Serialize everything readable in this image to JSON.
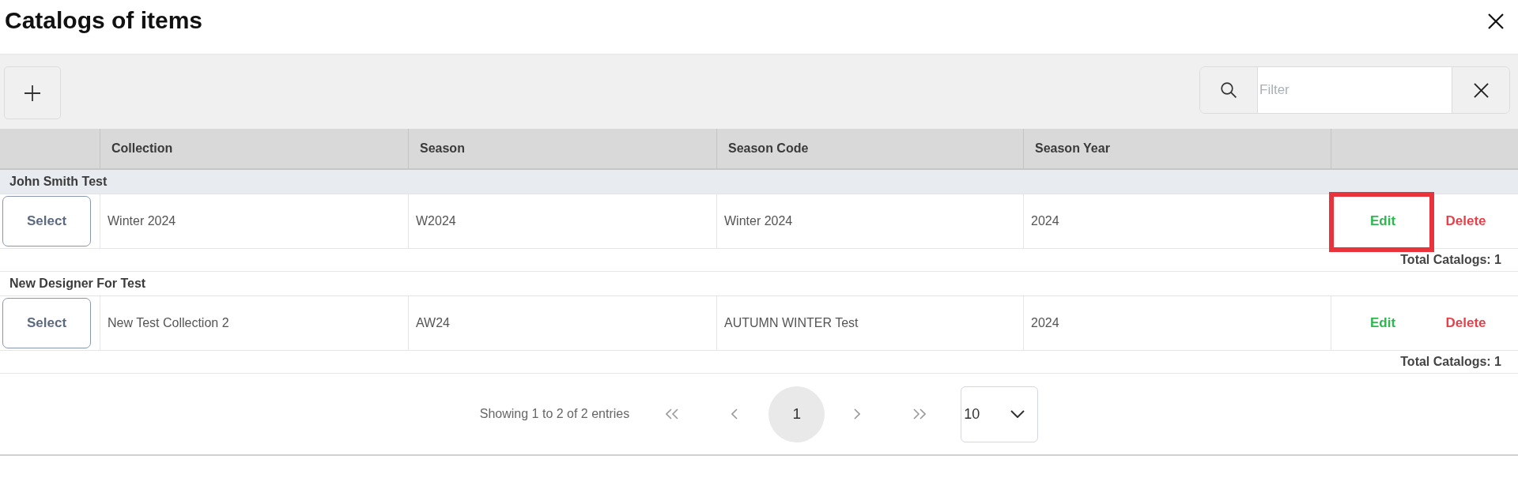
{
  "dialog": {
    "title": "Catalogs of items"
  },
  "toolbar": {
    "filter": {
      "placeholder": "Filter"
    }
  },
  "table": {
    "columns": [
      "Collection",
      "Season",
      "Season Code",
      "Season Year"
    ],
    "groups": [
      {
        "name": "John Smith Test",
        "highlighted": true,
        "rows": [
          {
            "select": "Select",
            "cells": [
              "Winter 2024",
              "W2024",
              "Winter 2024",
              "2024"
            ],
            "actions": [
              {
                "kind": "edit",
                "label": "Edit",
                "annotated": true
              },
              {
                "kind": "delete",
                "label": "Delete",
                "annotated": false
              }
            ]
          }
        ],
        "total": "Total Catalogs: 1"
      },
      {
        "name": "New Designer For Test",
        "highlighted": false,
        "rows": [
          {
            "select": "Select",
            "cells": [
              "New Test Collection 2",
              "AW24",
              "AUTUMN WINTER Test",
              "2024"
            ],
            "actions": [
              {
                "kind": "edit",
                "label": "Edit",
                "annotated": false
              },
              {
                "kind": "delete",
                "label": "Delete",
                "annotated": false
              }
            ]
          }
        ],
        "total": "Total Catalogs: 1"
      }
    ]
  },
  "pagination": {
    "summary": "Showing 1 to 2 of 2 entries",
    "pages": [
      {
        "label": "1",
        "selected": true
      }
    ],
    "page_size": "10"
  }
}
